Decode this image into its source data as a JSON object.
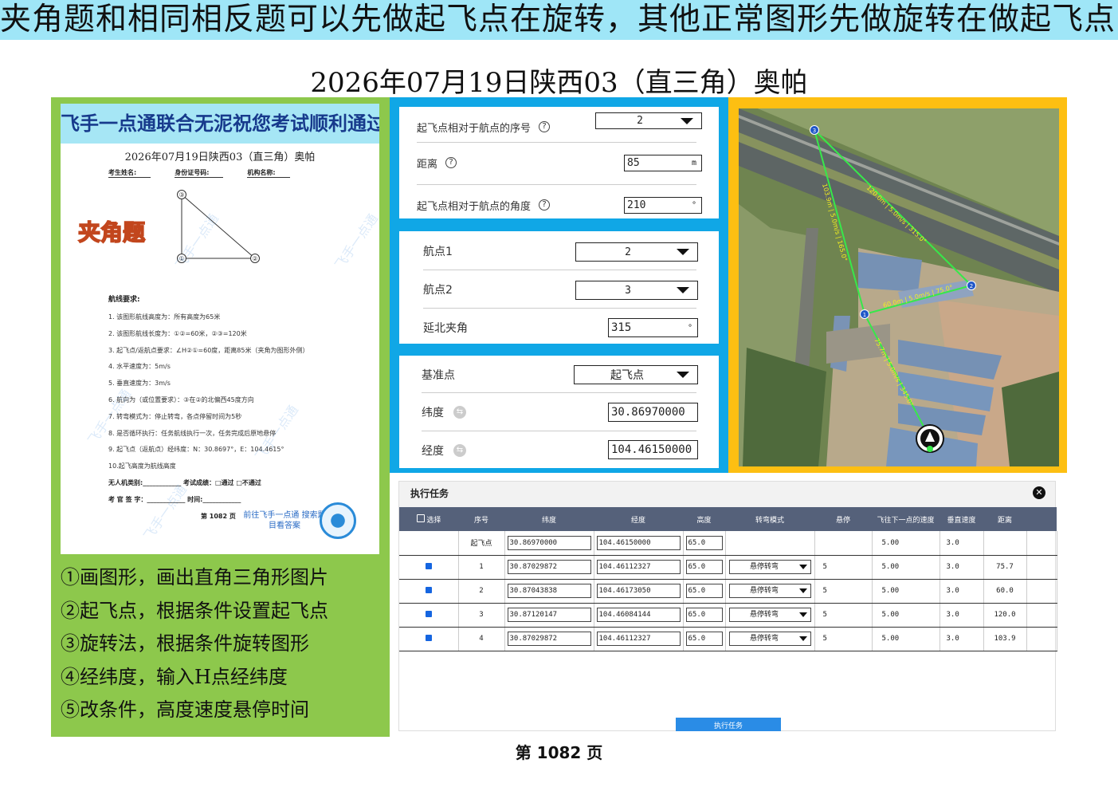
{
  "banner": "夹角题和相同相反题可以先做起飞点在旋转，其他正常图形先做旋转在做起飞点",
  "main_title": "2026年07月19日陕西03（直三角）奥帕",
  "paper": {
    "header": "飞手一点通联合无泥祝您考试顺利通过",
    "subtitle": "2026年07月19日陕西03（直三角）奥帕",
    "info": [
      "考生姓名:",
      "身份证号码:",
      "机构名称:"
    ],
    "badge": "夹角题",
    "points": [
      "①",
      "②",
      "③"
    ],
    "req_title": "航线要求:",
    "requirements": [
      "1. 该图形航线高度为：所有高度为65米",
      "2. 该图形航线长度为：①②=60米，②③=120米",
      "3. 起飞点/返航点要求：∠H②①=60度，距离85米（夹角为图形外侧）",
      "4. 水平速度为：5m/s",
      "5. 垂直速度为：3m/s",
      "6. 航向为（或位置要求）：③在②的北偏西45度方向",
      "7. 转弯模式为：停止转弯，各点停留时间为5秒",
      "8. 是否循环执行：任务航线执行一次，任务完成后原地悬停",
      "9. 起飞点（返航点）经纬度：N：30.8697°，E：104.4615°",
      "10.起飞高度为航线高度"
    ],
    "foot1": "无人机类别:____________  考试成绩：□通过  □不通过",
    "foot2": "考 官 签 字：____________  时间:____________",
    "foot3": "第 1082 页",
    "link": "前往飞手一点通 搜索题目看答案",
    "watermark": "飞手一点通"
  },
  "steps": [
    "①画图形，画出直角三角形图片",
    "②起飞点，根据条件设置起飞点",
    "③旋转法，根据条件旋转图形",
    "④经纬度，输入H点经纬度",
    "⑤改条件，高度速度悬停时间"
  ],
  "form1": {
    "seq_label": "起飞点相对于航点的序号",
    "seq_value": "2",
    "dist_label": "距离",
    "dist_value": "85",
    "dist_unit": "m",
    "angle_label": "起飞点相对于航点的角度",
    "angle_value": "210",
    "angle_unit": "°",
    "help": "?"
  },
  "form2": {
    "wp1_label": "航点1",
    "wp1_value": "2",
    "wp2_label": "航点2",
    "wp2_value": "3",
    "north_label": "延北夹角",
    "north_value": "315",
    "north_unit": "°"
  },
  "form3": {
    "base_label": "基准点",
    "base_value": "起飞点",
    "lat_label": "纬度",
    "lat_value": "30.86970000",
    "lng_label": "经度",
    "lng_value": "104.46150000",
    "swap": "⇆"
  },
  "map": {
    "labels": [
      "1",
      "2",
      "3"
    ],
    "seg_3_2": "120.0m | 5.0m/s | 315.0°",
    "seg_1_2": "60.0m | 5.0m/s | 75.0°",
    "seg_3_1": "103.9m | 5.0m/s | 165.0°",
    "seg_h_1": "75.7m | 5.0m/s | 345.0°"
  },
  "task": {
    "title": "执行任务",
    "close": "✕",
    "headers": [
      "选择",
      "序号",
      "纬度",
      "经度",
      "高度",
      "转弯模式",
      "悬停",
      "飞往下一点的速度",
      "垂直速度",
      "距离"
    ],
    "rows": [
      {
        "seq": "起飞点",
        "lat": "30.86970000",
        "lng": "104.46150000",
        "alt": "65.0",
        "mode": "",
        "hover": "",
        "speed": "5.00",
        "vspeed": "3.0",
        "dist": ""
      },
      {
        "seq": "1",
        "lat": "30.87029872",
        "lng": "104.46112327",
        "alt": "65.0",
        "mode": "悬停转弯",
        "hover": "5",
        "speed": "5.00",
        "vspeed": "3.0",
        "dist": "75.7"
      },
      {
        "seq": "2",
        "lat": "30.87043838",
        "lng": "104.46173050",
        "alt": "65.0",
        "mode": "悬停转弯",
        "hover": "5",
        "speed": "5.00",
        "vspeed": "3.0",
        "dist": "60.0"
      },
      {
        "seq": "3",
        "lat": "30.87120147",
        "lng": "104.46084144",
        "alt": "65.0",
        "mode": "悬停转弯",
        "hover": "5",
        "speed": "5.00",
        "vspeed": "3.0",
        "dist": "120.0"
      },
      {
        "seq": "4",
        "lat": "30.87029872",
        "lng": "104.46112327",
        "alt": "65.0",
        "mode": "悬停转弯",
        "hover": "5",
        "speed": "5.00",
        "vspeed": "3.0",
        "dist": "103.9"
      }
    ],
    "exec_button": "执行任务"
  },
  "page_footer": "第 1082 页",
  "colors": {
    "banner": "#9fe6f7",
    "left_panel": "#8dc84c",
    "form_frame": "#10a7e6",
    "map_frame": "#fdbf12",
    "route": "#37e84a"
  }
}
